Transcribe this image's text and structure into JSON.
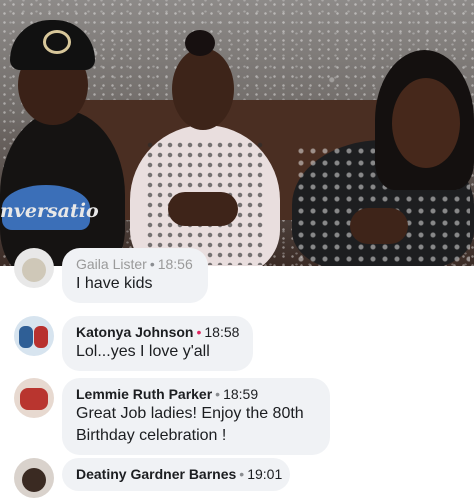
{
  "comments": [
    {
      "name": "Gaila Lister",
      "time": "18:56",
      "text": "I have kids",
      "live_dot": false
    },
    {
      "name": "Katonya Johnson",
      "time": "18:58",
      "text": "Lol...yes I love y'all",
      "live_dot": true
    },
    {
      "name": "Lemmie Ruth Parker",
      "time": "18:59",
      "text": "Great Job ladies!  Enjoy the 80th Birthday  celebration !",
      "live_dot": false
    },
    {
      "name": "Deatiny Gardner Barnes",
      "time": "19:01",
      "text": "",
      "live_dot": false
    }
  ],
  "video": {
    "shirt_text": "nversatio"
  },
  "colors": {
    "bubble": "#f0f2f5",
    "live_dot": "#e0245e",
    "text": "#1c1e21"
  }
}
